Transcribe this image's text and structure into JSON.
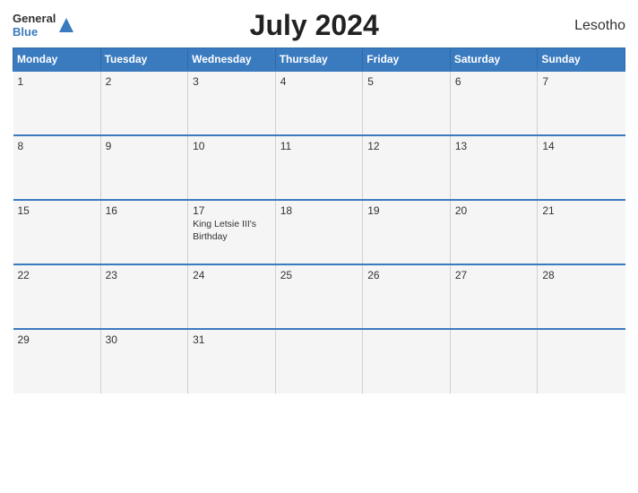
{
  "header": {
    "logo_general": "General",
    "logo_blue": "Blue",
    "title": "July 2024",
    "country": "Lesotho"
  },
  "calendar": {
    "days_of_week": [
      "Monday",
      "Tuesday",
      "Wednesday",
      "Thursday",
      "Friday",
      "Saturday",
      "Sunday"
    ],
    "weeks": [
      [
        {
          "date": "1",
          "event": ""
        },
        {
          "date": "2",
          "event": ""
        },
        {
          "date": "3",
          "event": ""
        },
        {
          "date": "4",
          "event": ""
        },
        {
          "date": "5",
          "event": ""
        },
        {
          "date": "6",
          "event": ""
        },
        {
          "date": "7",
          "event": ""
        }
      ],
      [
        {
          "date": "8",
          "event": ""
        },
        {
          "date": "9",
          "event": ""
        },
        {
          "date": "10",
          "event": ""
        },
        {
          "date": "11",
          "event": ""
        },
        {
          "date": "12",
          "event": ""
        },
        {
          "date": "13",
          "event": ""
        },
        {
          "date": "14",
          "event": ""
        }
      ],
      [
        {
          "date": "15",
          "event": ""
        },
        {
          "date": "16",
          "event": ""
        },
        {
          "date": "17",
          "event": "King Letsie III's Birthday"
        },
        {
          "date": "18",
          "event": ""
        },
        {
          "date": "19",
          "event": ""
        },
        {
          "date": "20",
          "event": ""
        },
        {
          "date": "21",
          "event": ""
        }
      ],
      [
        {
          "date": "22",
          "event": ""
        },
        {
          "date": "23",
          "event": ""
        },
        {
          "date": "24",
          "event": ""
        },
        {
          "date": "25",
          "event": ""
        },
        {
          "date": "26",
          "event": ""
        },
        {
          "date": "27",
          "event": ""
        },
        {
          "date": "28",
          "event": ""
        }
      ],
      [
        {
          "date": "29",
          "event": ""
        },
        {
          "date": "30",
          "event": ""
        },
        {
          "date": "31",
          "event": ""
        },
        {
          "date": "",
          "event": ""
        },
        {
          "date": "",
          "event": ""
        },
        {
          "date": "",
          "event": ""
        },
        {
          "date": "",
          "event": ""
        }
      ]
    ]
  }
}
